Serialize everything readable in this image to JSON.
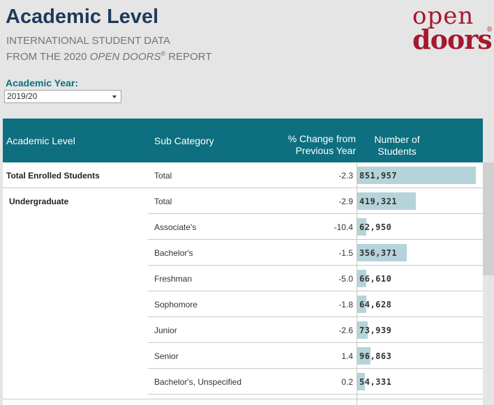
{
  "header": {
    "title": "Academic Level",
    "subtitle_line1": "INTERNATIONAL STUDENT DATA",
    "subtitle_prefix": "FROM THE 2020 ",
    "subtitle_em": "OPEN DOORS",
    "subtitle_reg": "®",
    "subtitle_suffix": " REPORT"
  },
  "logo": {
    "line1": "open",
    "line2": "doors",
    "reg": "®",
    "color": "#a3192f"
  },
  "filter": {
    "label": "Academic Year:",
    "selected": "2019/20"
  },
  "table": {
    "header_color": "#0d6f7f",
    "bar_color": "#b4d4d9",
    "columns": {
      "level": "Academic Level",
      "sub": "Sub Category",
      "pct_line1": "% Change from",
      "pct_line2": "Previous Year",
      "num_line1": "Number of",
      "num_line2": "Students"
    },
    "rows": [
      {
        "level": "Total Enrolled Students",
        "sub": "Total",
        "pct": "-2.3",
        "num": "851,957",
        "value": 851957
      },
      {
        "level": "Undergraduate",
        "sub": "Total",
        "pct": "-2.9",
        "num": "419,321",
        "value": 419321
      },
      {
        "level": "",
        "sub": "Associate's",
        "pct": "-10.4",
        "num": "62,950",
        "value": 62950
      },
      {
        "level": "",
        "sub": "Bachelor's",
        "pct": "-1.5",
        "num": "356,371",
        "value": 356371
      },
      {
        "level": "",
        "sub": "Freshman",
        "pct": "-5.0",
        "num": "66,610",
        "value": 66610
      },
      {
        "level": "",
        "sub": "Sophomore",
        "pct": "-1.8",
        "num": "64,628",
        "value": 64628
      },
      {
        "level": "",
        "sub": "Junior",
        "pct": "-2.6",
        "num": "73,939",
        "value": 73939
      },
      {
        "level": "",
        "sub": "Senior",
        "pct": "1.4",
        "num": "96,863",
        "value": 96863
      },
      {
        "level": "",
        "sub": "Bachelor's, Unspecified",
        "pct": "0.2",
        "num": "54,331",
        "value": 54331
      }
    ]
  }
}
